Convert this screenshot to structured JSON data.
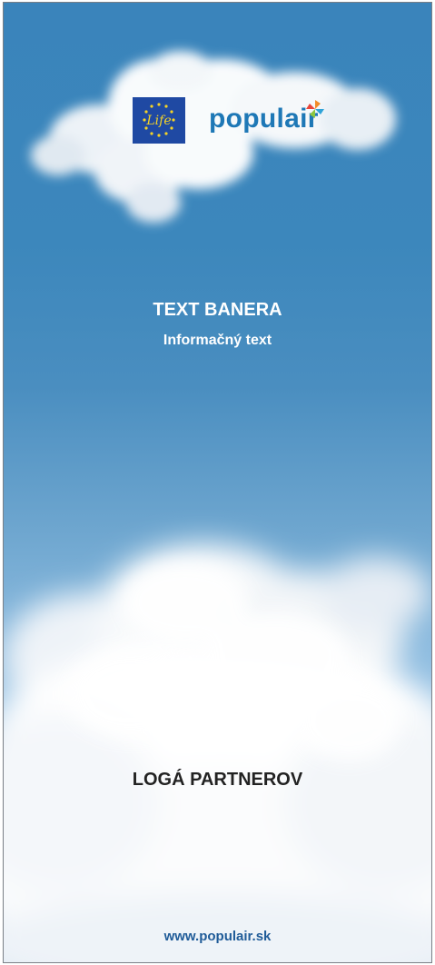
{
  "banner": {
    "logo": {
      "eu_flag_text": "Life",
      "brand_name": "populair",
      "icon": "pinwheel-icon"
    },
    "title": "TEXT BANERA",
    "subtitle": "Informačný text",
    "partners_label": "LOGÁ PARTNEROV",
    "website": "www.populair.sk"
  },
  "colors": {
    "sky_top": "#3a84bb",
    "sky_bottom": "#c7ddef",
    "brand_blue": "#1e78b6",
    "eu_blue": "#1f49a3",
    "eu_star": "#f5d327",
    "url_blue": "#1f5b98"
  }
}
